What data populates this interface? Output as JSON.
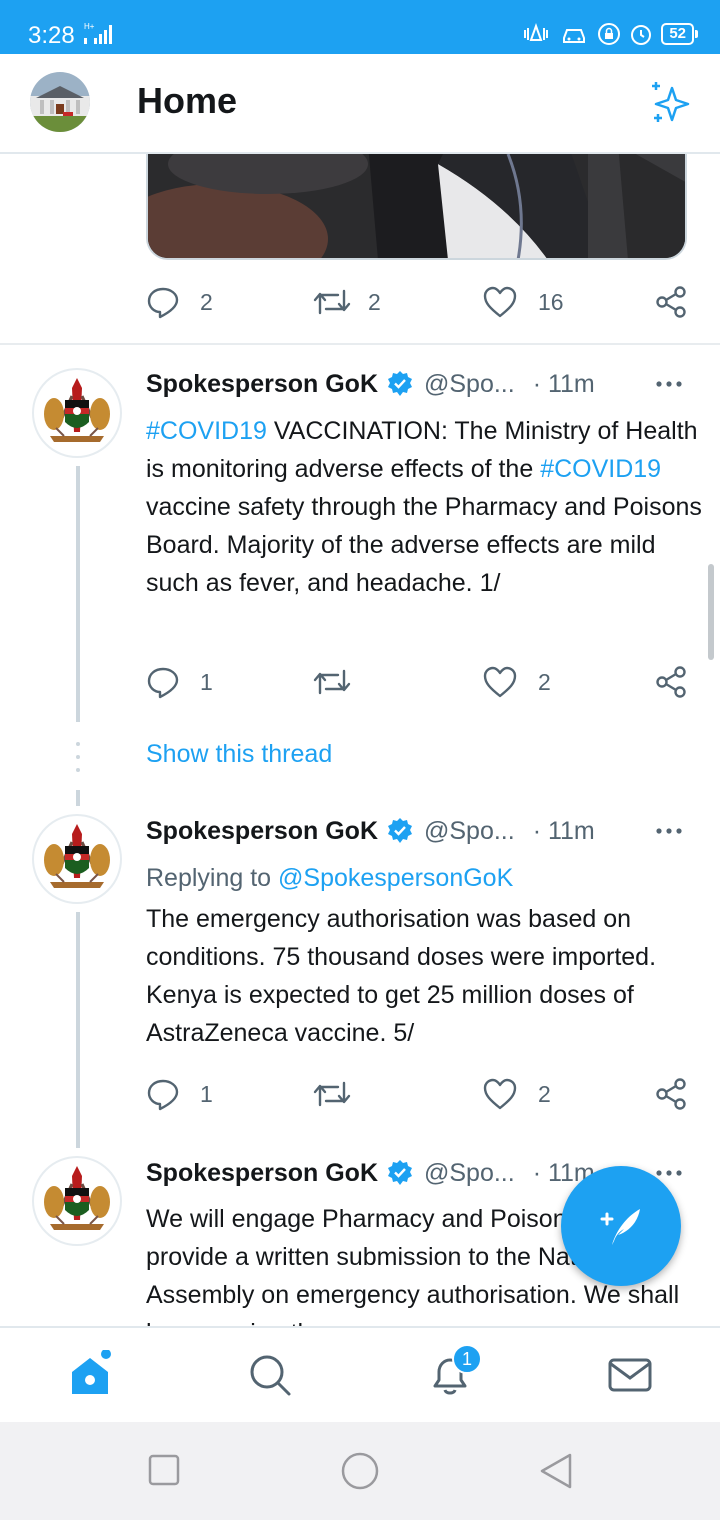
{
  "status_bar": {
    "time": "3:28",
    "network": "H+",
    "battery": "52"
  },
  "header": {
    "title": "Home"
  },
  "top_tweet_actions": {
    "replies": "2",
    "retweets": "2",
    "likes": "16"
  },
  "tweets": [
    {
      "name": "Spokesperson GoK",
      "handle": "@Spo...",
      "time": "· 11m",
      "body": [
        {
          "text": "#COVID19",
          "link": true
        },
        {
          "text": " VACCINATION: The Ministry of Health is monitoring adverse effects of the ",
          "link": false
        },
        {
          "text": "#COVID19",
          "link": true
        },
        {
          "text": " vaccine safety through the Pharmacy and Poisons Board.  Majority of the adverse effects are mild such as fever, and headache. 1/",
          "link": false
        }
      ],
      "replies": "1",
      "retweets": "",
      "likes": "2",
      "show_thread": "Show this thread"
    },
    {
      "name": "Spokesperson GoK",
      "handle": "@Spo...",
      "time": "· 11m",
      "replying_prefix": "Replying to",
      "replying_to": "@SpokespersonGoK",
      "body_text": "The emergency authorisation was based on conditions. 75 thousand doses were imported. Kenya is expected to get 25 million doses of AstraZeneca vaccine. 5/",
      "replies": "1",
      "retweets": "",
      "likes": "2"
    },
    {
      "name": "Spokesperson GoK",
      "handle": "@Spo...",
      "time": "· 11m",
      "body_text": "We will engage Pharmacy and Poisons Board to provide a written submission to the National Assembly on emergency authorisation. We shall be engaging the"
    }
  ],
  "bottom_nav": {
    "notification_count": "1"
  },
  "colors": {
    "brand_blue": "#1da1f2",
    "text_gray": "#536471",
    "divider": "#e1e8ed"
  },
  "icons": [
    "home-icon",
    "search-icon",
    "notifications-icon",
    "messages-icon",
    "compose-icon",
    "sparkle-icon",
    "reply-icon",
    "retweet-icon",
    "like-icon",
    "share-icon",
    "verified-icon",
    "more-icon"
  ]
}
